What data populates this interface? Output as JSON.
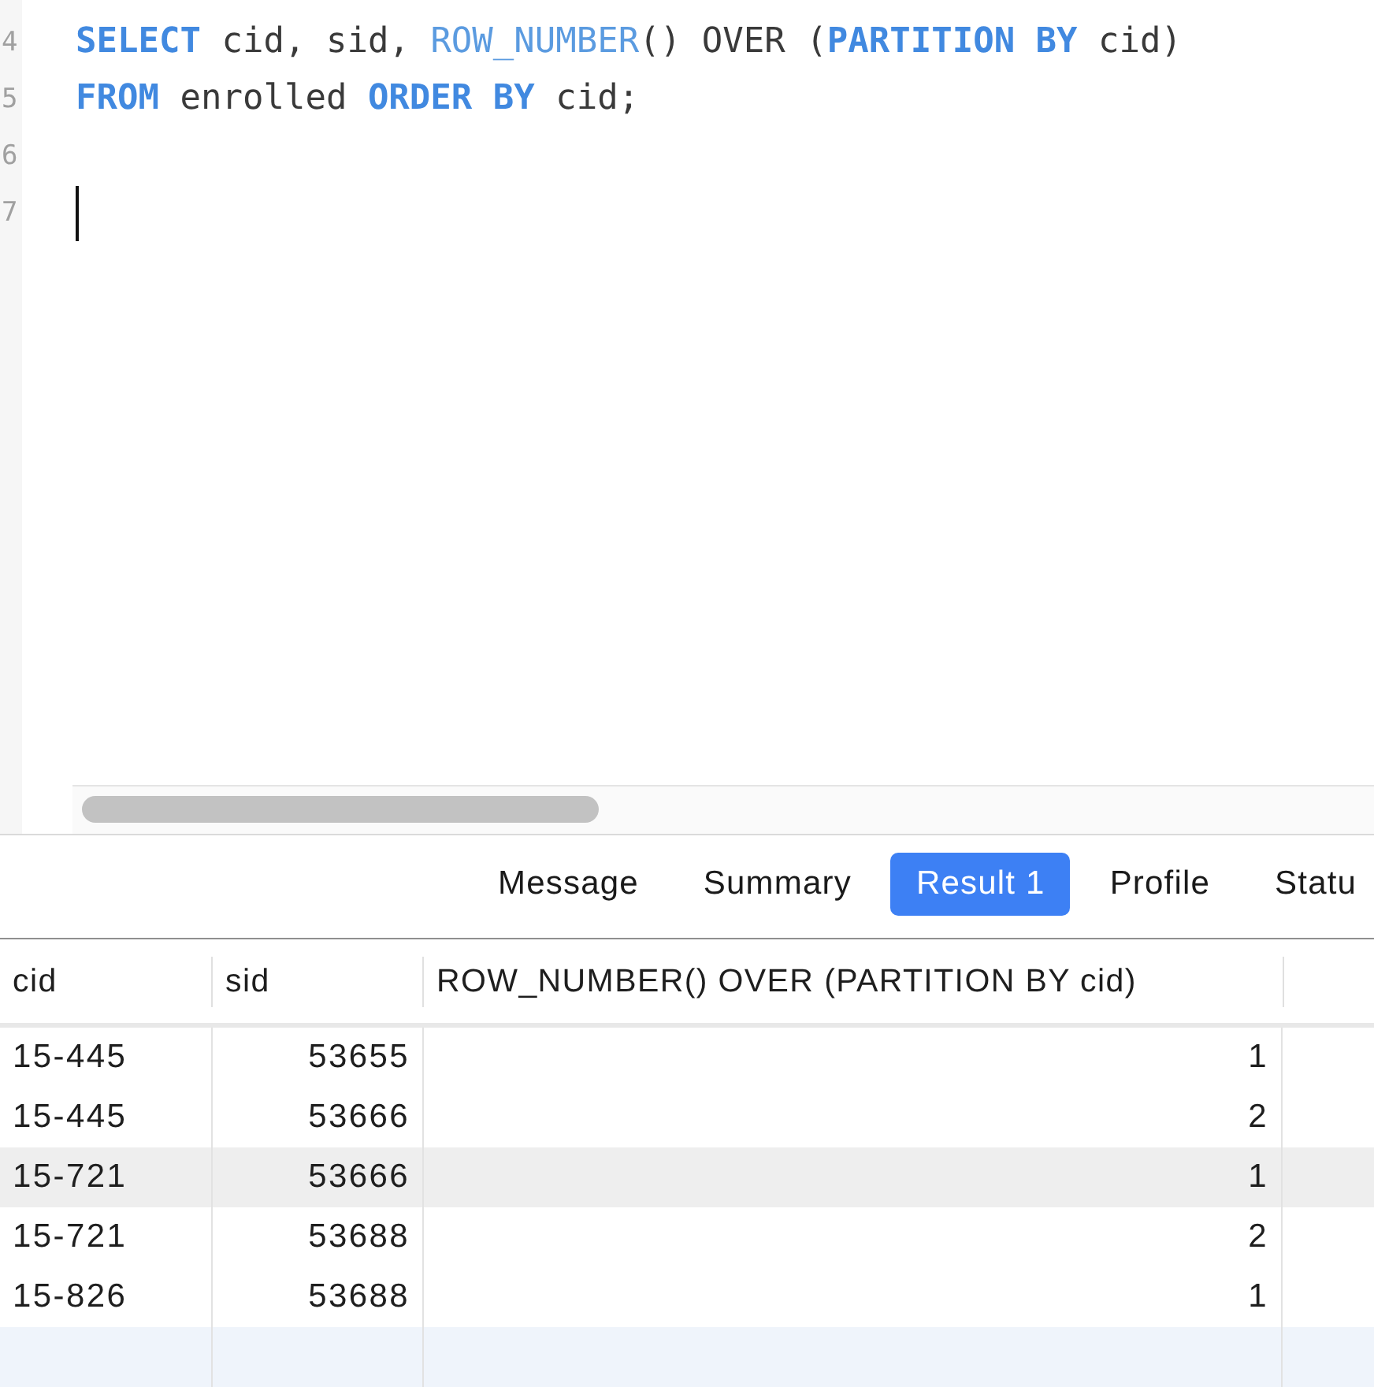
{
  "editor": {
    "lines": [
      {
        "number": "4",
        "tokens": [
          {
            "text": "SELECT",
            "kind": "keyword"
          },
          {
            "text": " cid, sid, ",
            "kind": "plain"
          },
          {
            "text": "ROW_NUMBER",
            "kind": "function"
          },
          {
            "text": "() OVER (",
            "kind": "plain"
          },
          {
            "text": "PARTITION BY",
            "kind": "keyword"
          },
          {
            "text": " cid)",
            "kind": "plain"
          }
        ],
        "cursor": false
      },
      {
        "number": "5",
        "tokens": [
          {
            "text": "FROM",
            "kind": "keyword"
          },
          {
            "text": " enrolled ",
            "kind": "plain"
          },
          {
            "text": "ORDER BY",
            "kind": "keyword"
          },
          {
            "text": " cid;",
            "kind": "plain"
          }
        ],
        "cursor": false
      },
      {
        "number": "6",
        "cursor": false
      },
      {
        "number": "7",
        "cursor": true
      }
    ]
  },
  "tabs": [
    {
      "label": "Message",
      "selected": false
    },
    {
      "label": "Summary",
      "selected": false
    },
    {
      "label": "Result 1",
      "selected": true
    },
    {
      "label": "Profile",
      "selected": false
    },
    {
      "label": "Statu",
      "selected": false
    }
  ],
  "table": {
    "columns": [
      "cid",
      "sid",
      "ROW_NUMBER() OVER (PARTITION BY cid)"
    ],
    "rows": [
      {
        "cells": [
          "15-445",
          "53655",
          "1"
        ],
        "highlighted": false
      },
      {
        "cells": [
          "15-445",
          "53666",
          "2"
        ],
        "highlighted": false
      },
      {
        "cells": [
          "15-721",
          "53666",
          "1"
        ],
        "highlighted": true
      },
      {
        "cells": [
          "15-721",
          "53688",
          "2"
        ],
        "highlighted": false
      },
      {
        "cells": [
          "15-826",
          "53688",
          "1"
        ],
        "highlighted": false
      }
    ]
  }
}
